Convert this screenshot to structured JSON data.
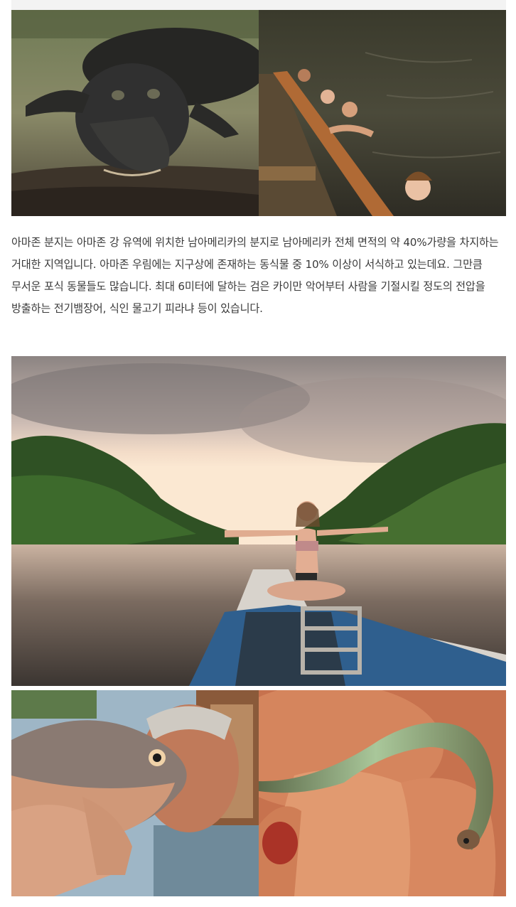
{
  "article": {
    "paragraph": "아마존 분지는 아마존 강 유역에 위치한 남아메리카의 분지로 남아메리카 전체 면적의 약 40%가량을 차지하는 거대한 지역입니다. 아마존 우림에는 지구상에 존재하는 동식물 중 10% 이상이 서식하고 있는데요. 그만큼 무서운 포식 동물들도 많습니다. 최대 6미터에 달하는 검은 카이만 악어부터 사람을 기절시킬 정도의 전압을 방출하는 전기뱀장어, 식인 물고기 피라냐 등이 있습니다."
  },
  "colors": {
    "text": "#3a3a3a",
    "background": "#ffffff"
  },
  "images": [
    {
      "name": "black caiman photo"
    },
    {
      "name": "swimmers beside canoe photo"
    },
    {
      "name": "woman on boat at sunset photo"
    },
    {
      "name": "man holding fish photo"
    },
    {
      "name": "small fish on hand photo"
    }
  ]
}
